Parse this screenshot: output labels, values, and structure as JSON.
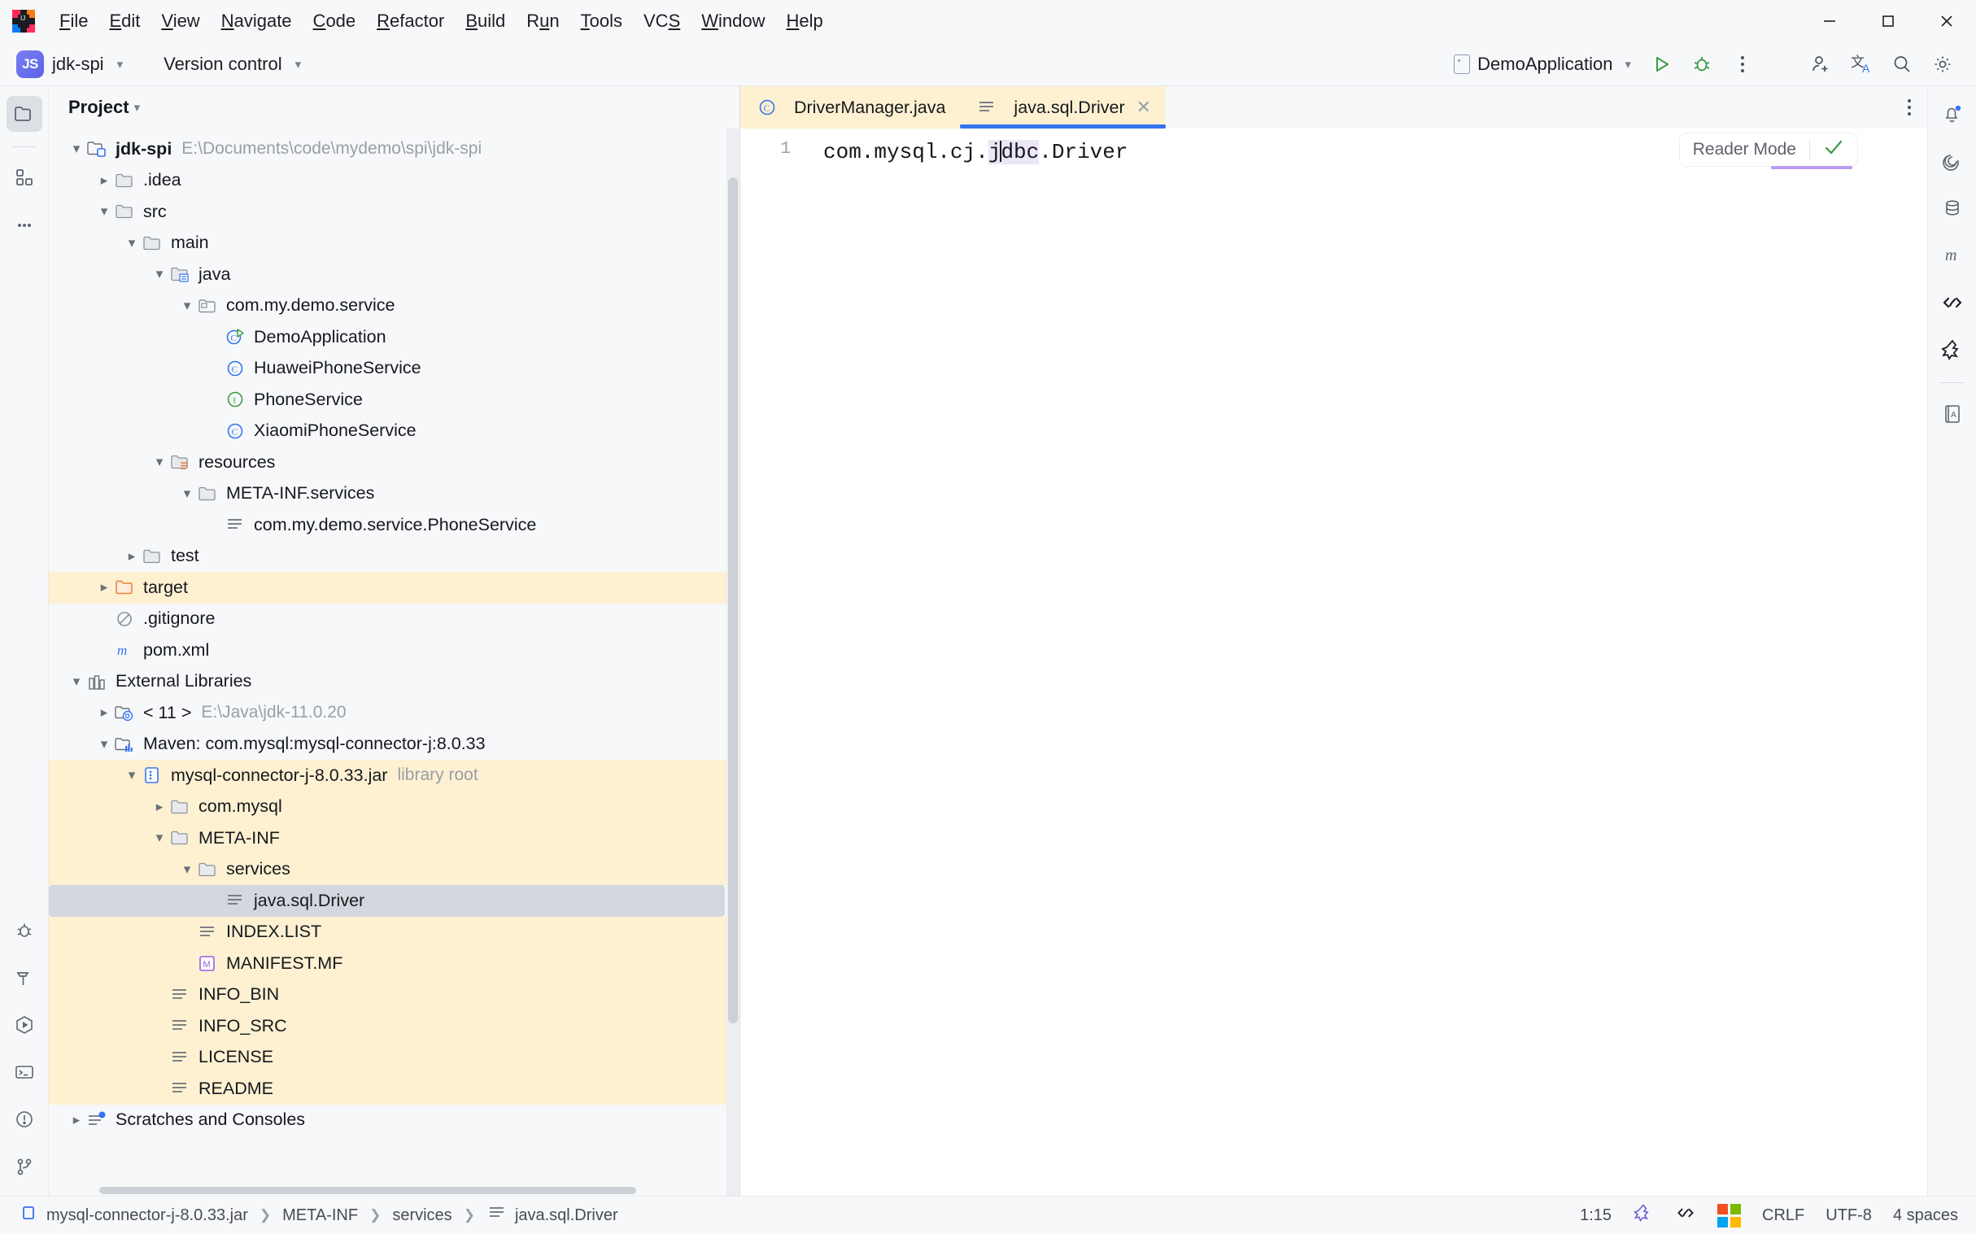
{
  "window": {
    "menus": [
      "File",
      "Edit",
      "View",
      "Navigate",
      "Code",
      "Refactor",
      "Build",
      "Run",
      "Tools",
      "VCS",
      "Window",
      "Help"
    ],
    "controls": {
      "minimize": "minimize-icon",
      "maximize": "maximize-icon",
      "close": "close-icon"
    }
  },
  "toolbar": {
    "project_badge": "JS",
    "project_name": "jdk-spi",
    "version_control": "Version control",
    "run_config": "DemoApplication",
    "run_label": "run-button",
    "debug_label": "debug-button",
    "more_label": "more-actions-button"
  },
  "project_panel": {
    "title": "Project",
    "tree": [
      {
        "indent": 0,
        "arrow": "down",
        "icon": "module-folder",
        "label": "jdk-spi",
        "bold": true,
        "sub": "E:\\Documents\\code\\mydemo\\spi\\jdk-spi"
      },
      {
        "indent": 1,
        "arrow": "right",
        "icon": "folder",
        "label": ".idea"
      },
      {
        "indent": 1,
        "arrow": "down",
        "icon": "folder",
        "label": "src"
      },
      {
        "indent": 2,
        "arrow": "down",
        "icon": "folder",
        "label": "main"
      },
      {
        "indent": 3,
        "arrow": "down",
        "icon": "folder-source",
        "label": "java"
      },
      {
        "indent": 4,
        "arrow": "down",
        "icon": "package",
        "label": "com.my.demo.service"
      },
      {
        "indent": 5,
        "arrow": "none",
        "icon": "class-runnable",
        "label": "DemoApplication"
      },
      {
        "indent": 5,
        "arrow": "none",
        "icon": "class",
        "label": "HuaweiPhoneService"
      },
      {
        "indent": 5,
        "arrow": "none",
        "icon": "interface",
        "label": "PhoneService"
      },
      {
        "indent": 5,
        "arrow": "none",
        "icon": "class",
        "label": "XiaomiPhoneService"
      },
      {
        "indent": 3,
        "arrow": "down",
        "icon": "folder-resources",
        "label": "resources"
      },
      {
        "indent": 4,
        "arrow": "down",
        "icon": "folder",
        "label": "META-INF.services"
      },
      {
        "indent": 5,
        "arrow": "none",
        "icon": "text-file",
        "label": "com.my.demo.service.PhoneService"
      },
      {
        "indent": 2,
        "arrow": "right",
        "icon": "folder",
        "label": "test"
      },
      {
        "indent": 1,
        "arrow": "right",
        "icon": "folder-excluded",
        "label": "target",
        "highlight": "yellow"
      },
      {
        "indent": 1,
        "arrow": "none",
        "icon": "gitignore",
        "label": ".gitignore"
      },
      {
        "indent": 1,
        "arrow": "none",
        "icon": "maven",
        "label": "pom.xml"
      },
      {
        "indent": 0,
        "arrow": "down",
        "icon": "libraries",
        "label": "External Libraries"
      },
      {
        "indent": 1,
        "arrow": "right",
        "icon": "jdk",
        "label": "< 11 >",
        "sub": "E:\\Java\\jdk-11.0.20"
      },
      {
        "indent": 1,
        "arrow": "down",
        "icon": "library",
        "label": "Maven: com.mysql:mysql-connector-j:8.0.33"
      },
      {
        "indent": 2,
        "arrow": "down",
        "icon": "jar",
        "label": "mysql-connector-j-8.0.33.jar",
        "sub": "library root",
        "highlight": "yellow"
      },
      {
        "indent": 3,
        "arrow": "right",
        "icon": "folder",
        "label": "com.mysql",
        "highlight": "yellow"
      },
      {
        "indent": 3,
        "arrow": "down",
        "icon": "folder",
        "label": "META-INF",
        "highlight": "yellow"
      },
      {
        "indent": 4,
        "arrow": "down",
        "icon": "folder",
        "label": "services",
        "highlight": "yellow"
      },
      {
        "indent": 5,
        "arrow": "none",
        "icon": "text-file",
        "label": "java.sql.Driver",
        "highlight": "selected"
      },
      {
        "indent": 4,
        "arrow": "none",
        "icon": "text-file",
        "label": "INDEX.LIST",
        "highlight": "yellow"
      },
      {
        "indent": 4,
        "arrow": "none",
        "icon": "manifest",
        "label": "MANIFEST.MF",
        "highlight": "yellow"
      },
      {
        "indent": 3,
        "arrow": "none",
        "icon": "text-file",
        "label": "INFO_BIN",
        "highlight": "yellow"
      },
      {
        "indent": 3,
        "arrow": "none",
        "icon": "text-file",
        "label": "INFO_SRC",
        "highlight": "yellow"
      },
      {
        "indent": 3,
        "arrow": "none",
        "icon": "text-file",
        "label": "LICENSE",
        "highlight": "yellow"
      },
      {
        "indent": 3,
        "arrow": "none",
        "icon": "text-file",
        "label": "README",
        "highlight": "yellow"
      },
      {
        "indent": 0,
        "arrow": "right",
        "icon": "scratches",
        "label": "Scratches and Consoles"
      }
    ]
  },
  "editor": {
    "tabs": [
      {
        "label": "DriverManager.java",
        "icon": "class",
        "active": false,
        "library": true,
        "closable": false
      },
      {
        "label": "java.sql.Driver",
        "icon": "text-file",
        "active": true,
        "library": true,
        "closable": true
      }
    ],
    "line_numbers": [
      "1"
    ],
    "code_before": "com.mysql.cj.",
    "code_highlight_pre": "j",
    "code_highlight_post": "dbc",
    "code_after": ".Driver",
    "full_line": "com.mysql.cj.jdbc.Driver",
    "reader_mode_label": "Reader Mode",
    "inspection_state": "ok"
  },
  "left_rail": [
    {
      "name": "project-tool-window",
      "icon": "folder-icon",
      "selected": true
    },
    {
      "name": "structure-tool-window",
      "icon": "structure-icon",
      "selected": false
    },
    {
      "name": "more-tool-windows",
      "icon": "ellipsis-icon",
      "selected": false
    }
  ],
  "left_rail_bottom": [
    {
      "name": "debug-tool-window",
      "icon": "bug-icon"
    },
    {
      "name": "build-tool-window",
      "icon": "hammer-icon"
    },
    {
      "name": "run-tool-window",
      "icon": "run-hexagon-icon"
    },
    {
      "name": "terminal-tool-window",
      "icon": "terminal-icon"
    },
    {
      "name": "problems-tool-window",
      "icon": "warning-circle-icon"
    },
    {
      "name": "git-tool-window",
      "icon": "git-branch-icon"
    }
  ],
  "right_rail": [
    {
      "name": "notifications",
      "icon": "bell-icon",
      "badge": true
    },
    {
      "name": "ai-assistant",
      "icon": "spiral-icon"
    },
    {
      "name": "database",
      "icon": "database-icon"
    },
    {
      "name": "maven",
      "icon": "maven-m-icon"
    },
    {
      "name": "code-with-me",
      "icon": "code-sync-icon"
    },
    {
      "name": "gitee",
      "icon": "gitee-icon"
    },
    {
      "name": "dictionary",
      "icon": "book-a-icon"
    }
  ],
  "status_bar": {
    "breadcrumb": [
      {
        "label": "mysql-connector-j-8.0.33.jar",
        "icon": "jar-icon"
      },
      {
        "label": "META-INF",
        "icon": "none"
      },
      {
        "label": "services",
        "icon": "none"
      },
      {
        "label": "java.sql.Driver",
        "icon": "text-file-icon"
      }
    ],
    "caret_position": "1:15",
    "line_separator": "CRLF",
    "encoding": "UTF-8",
    "indent": "4 spaces"
  },
  "colors": {
    "accent_blue": "#3574f0",
    "library_yellow": "#fdf1d2",
    "selection_gray": "#d4d7dd",
    "run_green": "#59a869",
    "panel_bg": "#f7f8fa"
  }
}
